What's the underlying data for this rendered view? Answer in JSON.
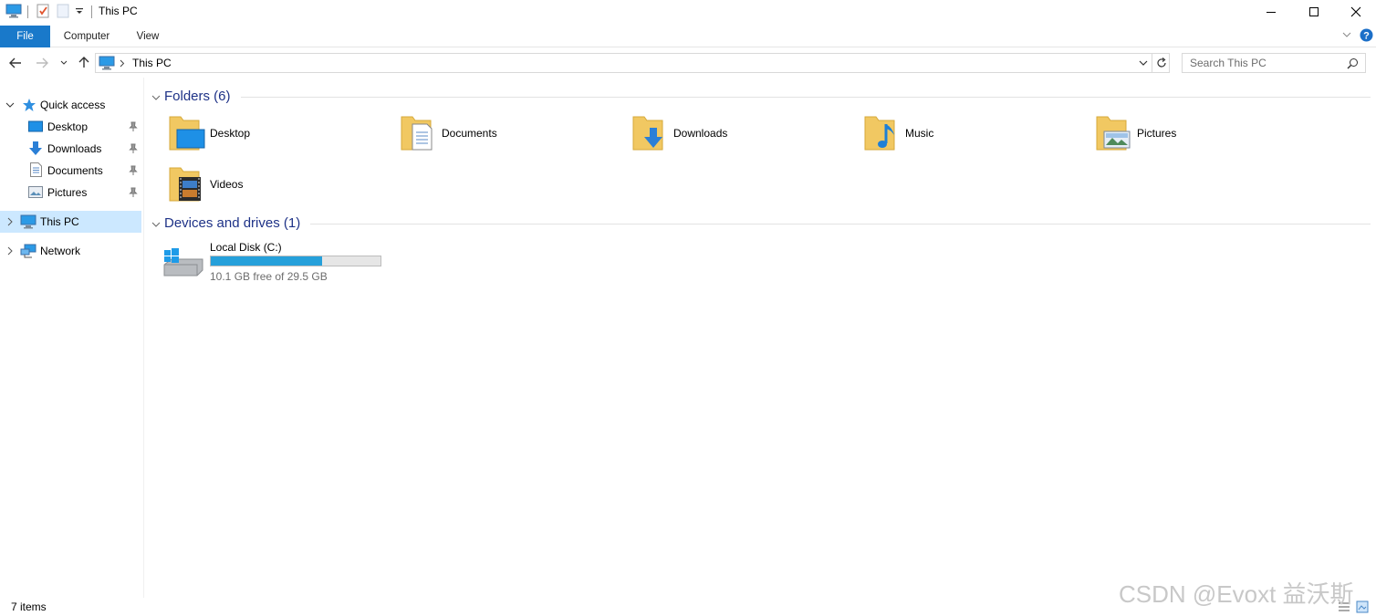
{
  "window": {
    "title": "This PC"
  },
  "ribbon": {
    "tabs": [
      "File",
      "Computer",
      "View"
    ]
  },
  "address": {
    "path": "This PC",
    "search_placeholder": "Search This PC"
  },
  "nav": {
    "quick_access": "Quick access",
    "quick_items": [
      "Desktop",
      "Downloads",
      "Documents",
      "Pictures"
    ],
    "this_pc": "This PC",
    "network": "Network"
  },
  "content": {
    "folders_header": "Folders (6)",
    "folders": [
      "Desktop",
      "Documents",
      "Downloads",
      "Music",
      "Pictures",
      "Videos"
    ],
    "devices_header": "Devices and drives (1)",
    "drive": {
      "name": "Local Disk (C:)",
      "free_text": "10.1 GB free of 29.5 GB",
      "used_fraction": 0.658
    }
  },
  "status": {
    "count": "7 items"
  },
  "watermark": "CSDN @Evoxt 益沃斯",
  "colors": {
    "accent": "#1979ca",
    "selected": "#cce8ff",
    "drive_fill": "#26a0da",
    "group_header": "#1e3287"
  }
}
